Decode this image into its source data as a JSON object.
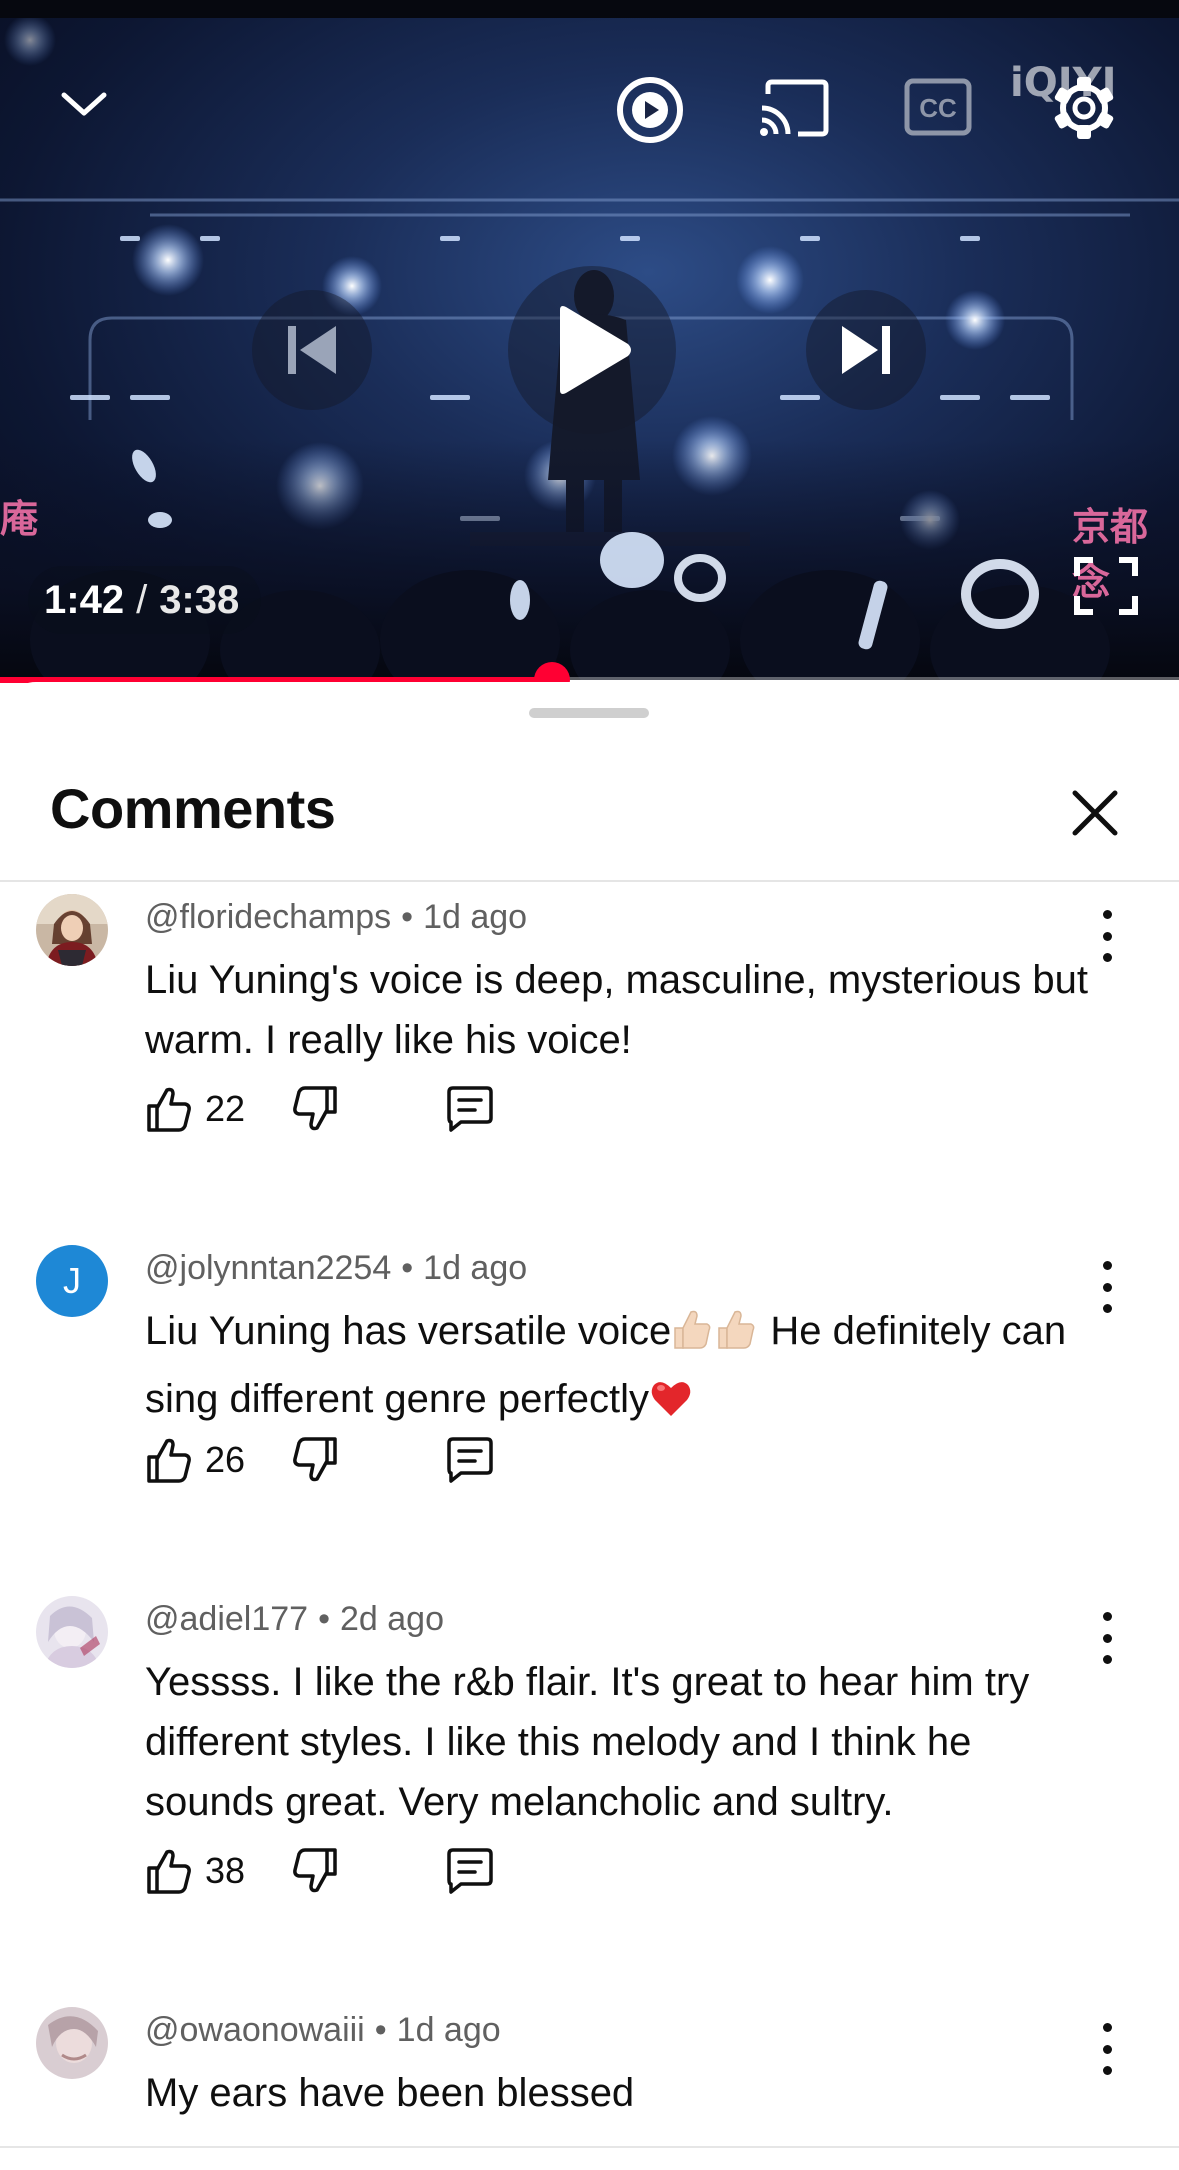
{
  "player": {
    "current_time": "1:42",
    "separator": "/",
    "duration": "3:38",
    "progress_fraction": 0.468,
    "watermark": "iQIYI",
    "side_text_left": "庵",
    "side_text_right": "京都念"
  },
  "sheet": {
    "title": "Comments"
  },
  "comments": [
    {
      "author": "@floridechamps",
      "time": "1d ago",
      "text": "Liu Yuning's voice is deep, masculine, mysterious but warm. I really like his voice!",
      "likes": "22",
      "avatar": "photo"
    },
    {
      "author": "@jolynntan2254",
      "time": "1d ago",
      "text_part1": "Liu Yuning has versatile voice",
      "text_part2": " He definitely can sing different genre perfectly",
      "emoji_after_part1": "thumbs-up-light-skin x2",
      "emoji_after_part2": "red-heart",
      "likes": "26",
      "avatar_letter": "J",
      "avatar_color": "#1e88d6"
    },
    {
      "author": "@adiel177",
      "time": "2d ago",
      "text": "Yessss. I like the r&b flair. It's great to hear him try different styles. I like this melody and I think he sounds great. Very melancholic and sultry.",
      "likes": "38",
      "avatar": "photo"
    },
    {
      "author": "@owaonowaiii",
      "time": "1d ago",
      "text": "My ears have been blessed",
      "avatar": "photo"
    }
  ],
  "colors": {
    "accent": "#ff0033",
    "meta_text": "#606060",
    "primary_text": "#0f0f0f"
  }
}
